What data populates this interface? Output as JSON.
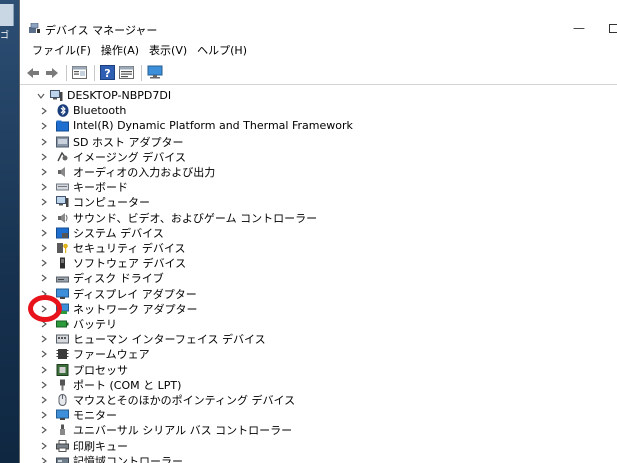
{
  "desktop": {
    "icon_label": "ゴ"
  },
  "window": {
    "title": "デバイス マネージャー",
    "minimize_label": "—"
  },
  "menu": [
    {
      "label": "ファイル(F)"
    },
    {
      "label": "操作(A)"
    },
    {
      "label": "表示(V)"
    },
    {
      "label": "ヘルプ(H)"
    }
  ],
  "toolbar": {
    "buttons": [
      "back-icon",
      "forward-icon",
      "properties-icon",
      "help-icon",
      "view-icon",
      "monitor-icon"
    ]
  },
  "tree": {
    "root": {
      "label": "DESKTOP-NBPD7DI",
      "icon": "computer-icon",
      "expanded": true
    },
    "items": [
      {
        "label": "Bluetooth",
        "icon": "bluetooth-icon"
      },
      {
        "label": "Intel(R) Dynamic Platform and Thermal Framework",
        "icon": "folder-icon"
      },
      {
        "label": "SD ホスト アダプター",
        "icon": "sd-host-icon"
      },
      {
        "label": "イメージング デバイス",
        "icon": "camera-icon"
      },
      {
        "label": "オーディオの入力および出力",
        "icon": "speaker-icon"
      },
      {
        "label": "キーボード",
        "icon": "keyboard-icon"
      },
      {
        "label": "コンピューター",
        "icon": "computer-icon"
      },
      {
        "label": "サウンド、ビデオ、およびゲーム コントローラー",
        "icon": "sound-icon"
      },
      {
        "label": "システム デバイス",
        "icon": "system-device-icon"
      },
      {
        "label": "セキュリティ デバイス",
        "icon": "security-device-icon"
      },
      {
        "label": "ソフトウェア デバイス",
        "icon": "software-device-icon"
      },
      {
        "label": "ディスク ドライブ",
        "icon": "disk-drive-icon"
      },
      {
        "label": "ディスプレイ アダプター",
        "icon": "display-adapter-icon"
      },
      {
        "label": "ネットワーク アダプター",
        "icon": "network-adapter-icon"
      },
      {
        "label": "バッテリ",
        "icon": "battery-icon"
      },
      {
        "label": "ヒューマン インターフェイス デバイス",
        "icon": "hid-icon"
      },
      {
        "label": "ファームウェア",
        "icon": "firmware-icon"
      },
      {
        "label": "プロセッサ",
        "icon": "processor-icon"
      },
      {
        "label": "ポート (COM と LPT)",
        "icon": "port-icon"
      },
      {
        "label": "マウスとそのほかのポインティング デバイス",
        "icon": "mouse-icon"
      },
      {
        "label": "モニター",
        "icon": "monitor-icon"
      },
      {
        "label": "ユニバーサル シリアル バス コントローラー",
        "icon": "usb-icon"
      },
      {
        "label": "印刷キュー",
        "icon": "printer-icon"
      },
      {
        "label": "記憶域コントローラー",
        "icon": "storage-controller-icon"
      }
    ]
  },
  "colors": {
    "annotation": "#e8121b",
    "accent": "#1e6fd0"
  }
}
